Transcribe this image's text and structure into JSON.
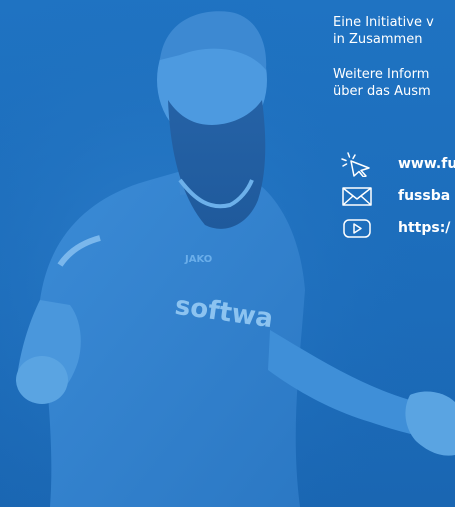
{
  "intro": {
    "line1": "Eine Initiative v",
    "line2": "in Zusammen"
  },
  "info": {
    "line1": "Weitere Inform",
    "line2": "über das Ausm"
  },
  "links": [
    {
      "icon": "cursor-click-icon",
      "text": "www.fu"
    },
    {
      "icon": "envelope-icon",
      "text": "fussba"
    },
    {
      "icon": "play-button-icon",
      "text": "https:/"
    }
  ],
  "colors": {
    "background": "#1f73c2",
    "text": "#ffffff"
  },
  "sponsor_text": "softwa",
  "kit_brand": "JAKO"
}
